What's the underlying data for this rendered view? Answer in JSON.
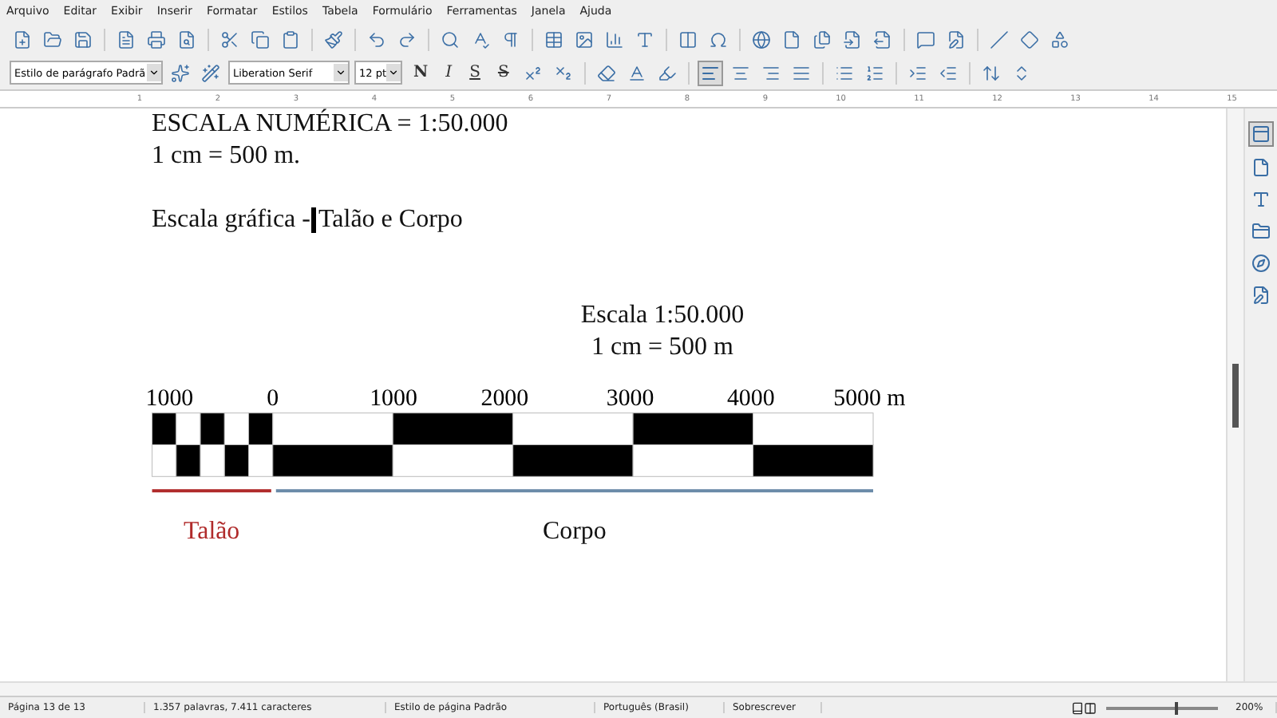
{
  "menu": [
    "Arquivo",
    "Editar",
    "Exibir",
    "Inserir",
    "Formatar",
    "Estilos",
    "Tabela",
    "Formulário",
    "Ferramentas",
    "Janela",
    "Ajuda"
  ],
  "formatting": {
    "paragraph_style": "Estilo de parágrafo Padrã",
    "font_name": "Liberation Serif",
    "font_size": "12 pt",
    "style_buttons": [
      "N",
      "I",
      "S",
      "S"
    ],
    "align_left_selected": true
  },
  "ruler_numbers": [
    "1",
    "2",
    "3",
    "4",
    "5",
    "6",
    "7",
    "8",
    "9",
    "10",
    "11",
    "12",
    "13",
    "14",
    "15"
  ],
  "document": {
    "lines": [
      {
        "text": "ESCALA NUMÉRICA = 1:50.000",
        "kind": "left"
      },
      {
        "text": "1 cm  = 500 m.",
        "kind": "left"
      },
      {
        "text": "Escala gráfica -",
        "after_cursor": "Talão e Corpo",
        "kind": "cursor"
      },
      {
        "text": "Escala 1:50.000",
        "kind": "center"
      },
      {
        "text": "1 cm = 500 m",
        "kind": "center"
      }
    ],
    "scale_bar": {
      "tick_labels": [
        "1000",
        "0",
        "1000",
        "2000",
        "3000",
        "4000",
        "5000 m"
      ],
      "sections": [
        {
          "label": "Talão",
          "color": "#b02a2a",
          "top_filled": [
            true,
            false,
            true,
            false,
            true
          ]
        },
        {
          "label": "Corpo",
          "color": "#6a8aa8",
          "top_filled": [
            false,
            true,
            false,
            true,
            false
          ]
        }
      ]
    }
  },
  "status_bar": {
    "page": "Página 13 de 13",
    "words": "1.357 palavras, 7.411 caracteres",
    "page_style": "Estilo de página Padrão",
    "language": "Português (Brasil)",
    "mode": "Sobrescrever",
    "zoom": "200%",
    "level": 0.62
  }
}
